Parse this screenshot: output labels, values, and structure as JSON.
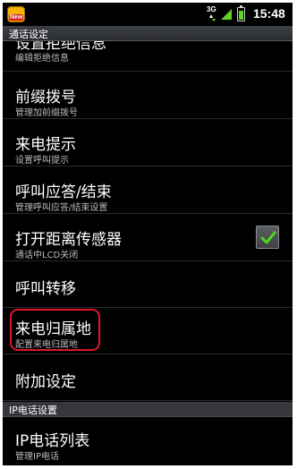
{
  "status_bar": {
    "app_badge_text": "New",
    "network_type": "3G",
    "time": "15:48"
  },
  "title": "通话设定",
  "items": [
    {
      "title": "设置拒绝信息",
      "subtitle": "编辑拒绝信息"
    },
    {
      "title": "前缀拨号",
      "subtitle": "管理加前缀拨号"
    },
    {
      "title": "来电提示",
      "subtitle": "设置呼叫提示"
    },
    {
      "title": "呼叫应答/结束",
      "subtitle": "管理呼叫应答/结束设置"
    },
    {
      "title": "打开距离传感器",
      "subtitle": "通话中LCD关闭",
      "checked": true
    },
    {
      "title": "呼叫转移"
    },
    {
      "title": "来电归属地",
      "subtitle": "配置来电归属地"
    },
    {
      "title": "附加设定"
    }
  ],
  "section_ip": {
    "header": "IP电话设置",
    "items": [
      {
        "title": "IP电话列表",
        "subtitle": "管理IP电话"
      }
    ]
  },
  "colors": {
    "background": "#000000",
    "highlight": "#e0162a",
    "checkbox_check": "#4ed41e"
  },
  "icons": {
    "app_badge": "new-badge-icon",
    "signal": "signal-icon",
    "battery": "battery-icon",
    "check": "check-icon"
  }
}
